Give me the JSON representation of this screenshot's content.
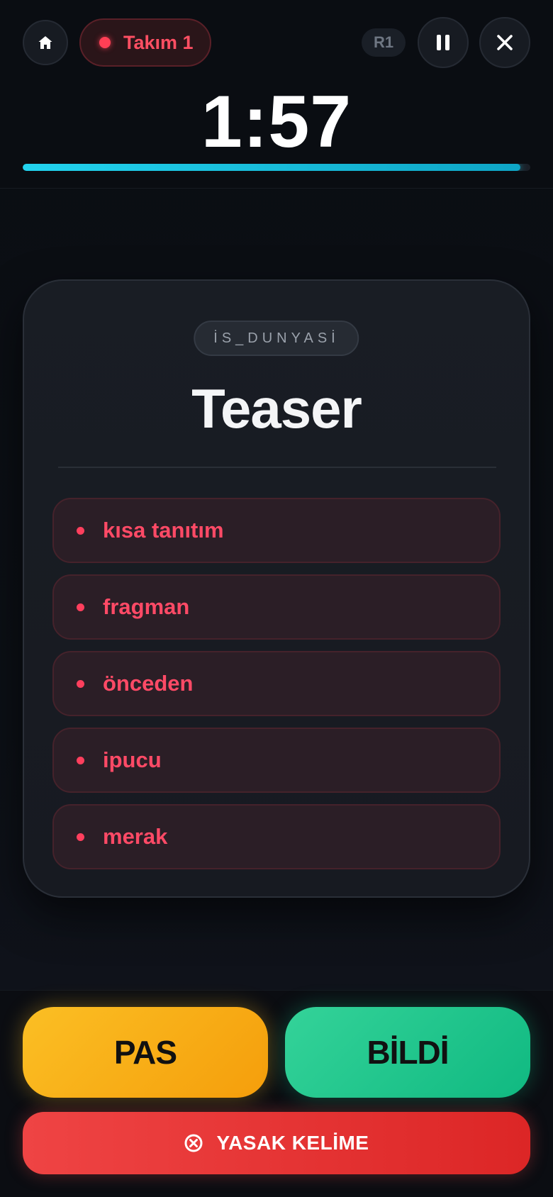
{
  "header": {
    "team_name": "Takım 1",
    "team_color": "#ff4f63",
    "round": "R1",
    "timer": "1:57",
    "time_remaining_fraction": 0.98,
    "icons": {
      "home": "home-icon",
      "pause": "pause-icon",
      "close": "close-icon"
    }
  },
  "card": {
    "category": "İS_DUNYASİ",
    "word": "Teaser",
    "taboo_words": [
      "kısa tanıtım",
      "fragman",
      "önceden",
      "ipucu",
      "merak"
    ]
  },
  "actions": {
    "pass_label": "PAS",
    "correct_label": "BİLDİ",
    "taboo_label": "YASAK KELİME",
    "pass_color": "#fbbf24",
    "correct_color": "#34d399",
    "taboo_color": "#ef4444"
  }
}
